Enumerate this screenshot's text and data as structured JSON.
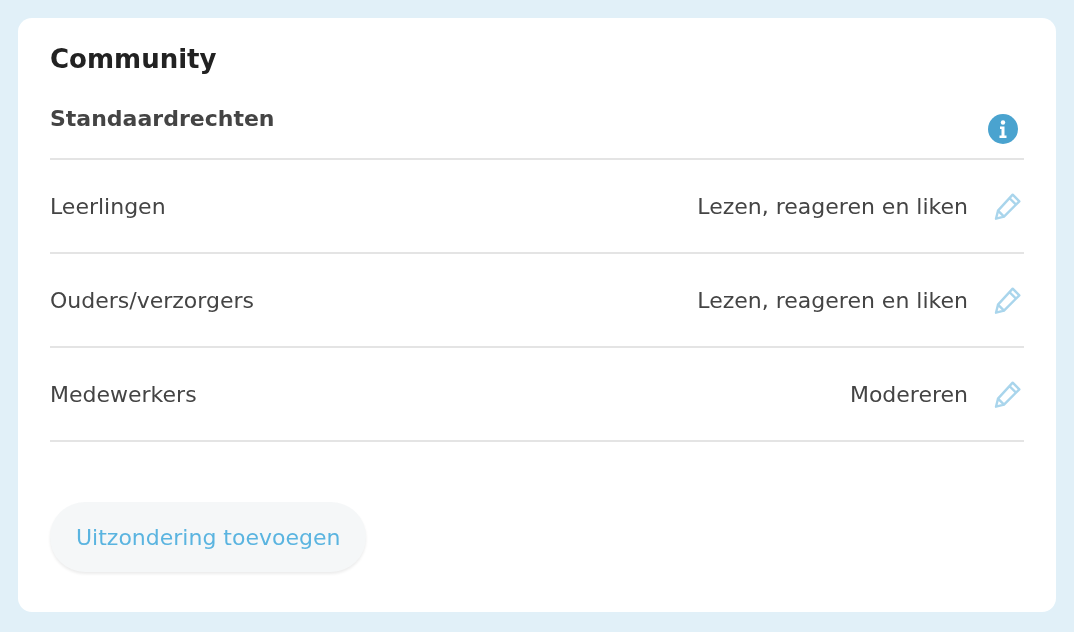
{
  "card": {
    "title": "Community",
    "section": {
      "title": "Standaardrechten"
    },
    "rows": [
      {
        "group": "Leerlingen",
        "permission": "Lezen, reageren en liken"
      },
      {
        "group": "Ouders/verzorgers",
        "permission": "Lezen, reageren en liken"
      },
      {
        "group": "Medewerkers",
        "permission": "Modereren"
      }
    ],
    "button": "Uitzondering toevoegen"
  }
}
